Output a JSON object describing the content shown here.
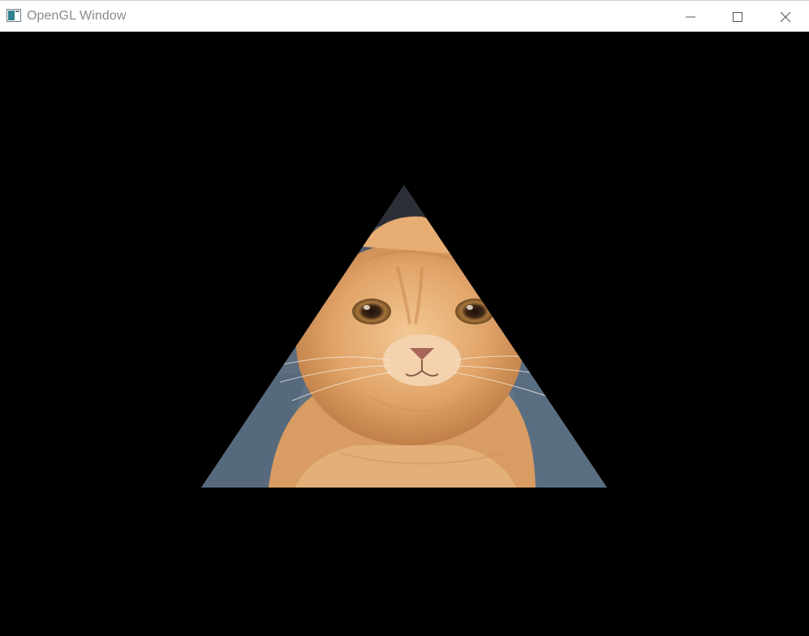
{
  "window": {
    "title": "OpenGL Window",
    "icon": "app-window-icon",
    "controls": {
      "minimize": "minimize-icon",
      "maximize": "maximize-icon",
      "close": "close-icon"
    }
  },
  "viewport": {
    "background": "#000000",
    "shape": "triangle",
    "texture": "cat-photo"
  },
  "colors": {
    "titlebar": "#ffffff",
    "title_text": "#8a8a8a",
    "cat_fur": "#e8b47c",
    "background_fabric": "#5f7285"
  }
}
